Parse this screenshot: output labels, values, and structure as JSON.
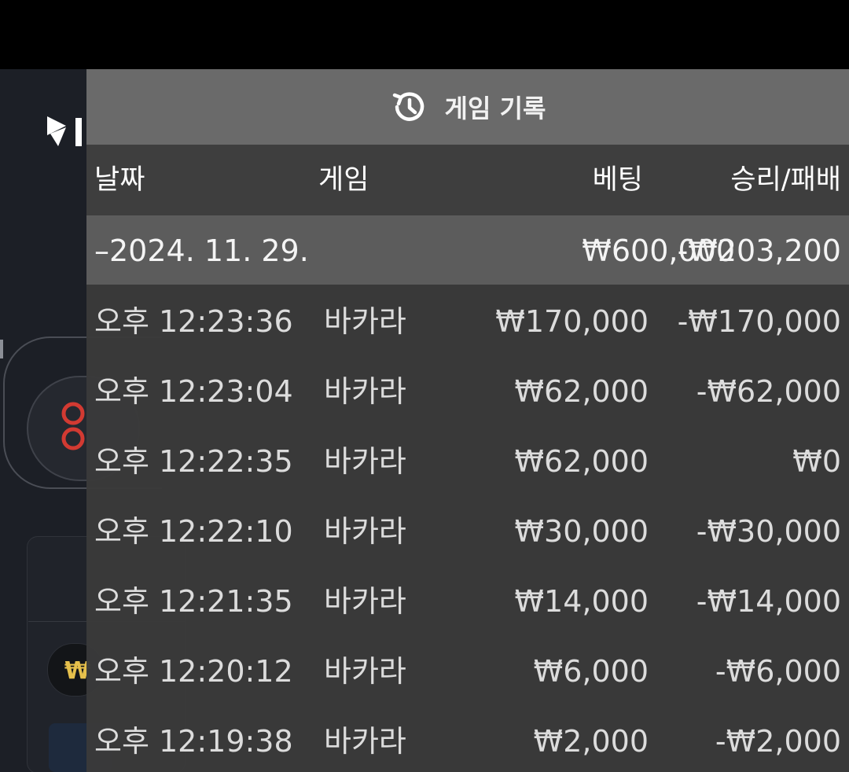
{
  "panel": {
    "title": "게임 기록",
    "icon": "history-icon"
  },
  "columns": {
    "date": "날짜",
    "game": "게임",
    "bet": "베팅",
    "win_loss": "승리/패배"
  },
  "summary": {
    "date": "–2024. 11. 29.",
    "bet": "₩600,000",
    "win_loss": "-₩203,200"
  },
  "rows": [
    {
      "time": "오후 12:23:36",
      "game": "바카라",
      "bet": "₩170,000",
      "win_loss": "-₩170,000"
    },
    {
      "time": "오후 12:23:04",
      "game": "바카라",
      "bet": "₩62,000",
      "win_loss": "-₩62,000"
    },
    {
      "time": "오후 12:22:35",
      "game": "바카라",
      "bet": "₩62,000",
      "win_loss": "₩0"
    },
    {
      "time": "오후 12:22:10",
      "game": "바카라",
      "bet": "₩30,000",
      "win_loss": "-₩30,000"
    },
    {
      "time": "오후 12:21:35",
      "game": "바카라",
      "bet": "₩14,000",
      "win_loss": "-₩14,000"
    },
    {
      "time": "오후 12:20:12",
      "game": "바카라",
      "bet": "₩6,000",
      "win_loss": "-₩6,000"
    },
    {
      "time": "오후 12:19:38",
      "game": "바카라",
      "bet": "₩2,000",
      "win_loss": "-₩2,000"
    }
  ],
  "background": {
    "chip_symbol": "₩"
  },
  "colors": {
    "header_bg": "#6a6a6a",
    "panel_bg": "#3a3a3a",
    "summary_bg": "#5c5c5c",
    "accent_red": "#d23a32",
    "chip_gold": "#e6c04c"
  }
}
